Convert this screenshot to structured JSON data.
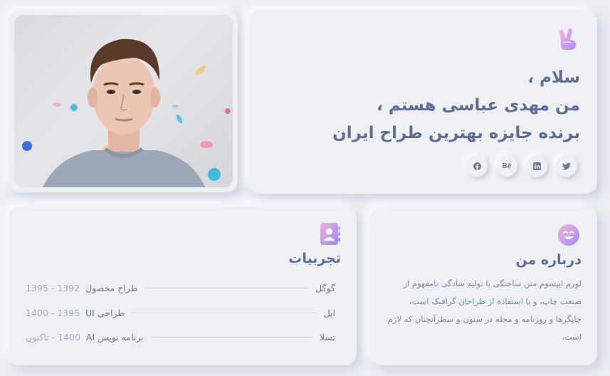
{
  "hero": {
    "line1": "سلام ،",
    "line2": "من مهدی عباسی هستم ،",
    "line3": "برنده جایزه بهترین طراح ایران",
    "emoji": "victory-hand-icon"
  },
  "socials": [
    {
      "icon": "twitter-icon",
      "glyph": "🐦"
    },
    {
      "icon": "linkedin-icon",
      "glyph": "in"
    },
    {
      "icon": "behance-icon",
      "glyph": "Bē"
    },
    {
      "icon": "facebook-icon",
      "glyph": "f"
    }
  ],
  "experiences": {
    "title": "تجربیات",
    "icon": "contact-book-icon",
    "items": [
      {
        "company": "گوگل",
        "role": "طراح محصول",
        "years": "1392 - 1395"
      },
      {
        "company": "اپل",
        "role": "طراحی UI",
        "years": "1395 - 1400"
      },
      {
        "company": "تسلا",
        "role": "برنامه نویس AI",
        "years": "1400 - تاکنون"
      }
    ]
  },
  "about": {
    "title": "درباره من",
    "icon": "smiling-face-icon",
    "body": "لورم ایپسوم متن ساختگی با تولید سادگی نامفهوم از صنعت چاپ، و با استفاده از طراحان گرافیک است، چاپگرها و روزنامه و مجله در ستون و سطرآنچنان که لازم است،"
  },
  "colors": {
    "background": "#eceef3",
    "card": "#eff0f4",
    "heading": "#5f6f93",
    "muted": "#a6afc2"
  }
}
